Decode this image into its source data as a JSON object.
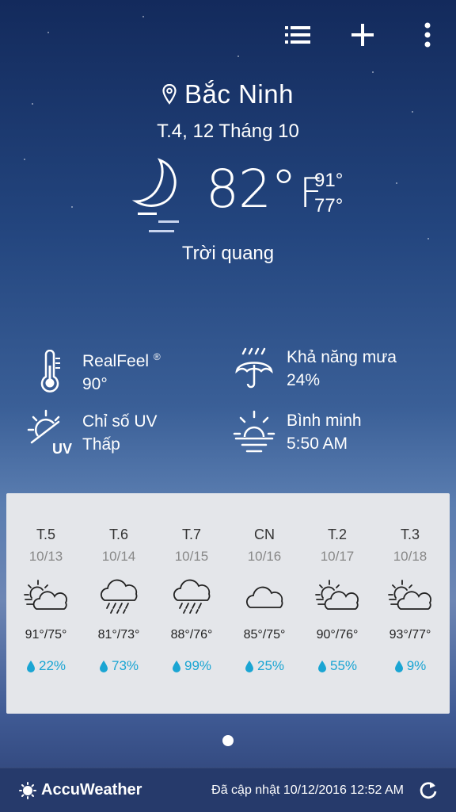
{
  "header": {
    "list_icon": "list-icon",
    "add_icon": "plus-icon",
    "menu_icon": "more-vert-icon"
  },
  "location": {
    "name": "Bắc Ninh",
    "icon": "location-pin-icon"
  },
  "date": "T.4, 12 Tháng 10",
  "current": {
    "temp": "82°",
    "unit": "F",
    "high": "91°",
    "low": "77°",
    "condition": "Trời quang",
    "icon": "moon-clear-night-icon"
  },
  "details": [
    {
      "label": "RealFeel",
      "sup": "®",
      "value": "90°",
      "icon": "thermometer-icon"
    },
    {
      "label": "Khả năng mưa",
      "value": "24%",
      "icon": "umbrella-rain-icon"
    },
    {
      "label": "Chỉ số UV",
      "value": "Thấp",
      "icon": "uv-index-icon"
    },
    {
      "label": "Bình minh",
      "value": "5:50 AM",
      "icon": "sunrise-icon"
    }
  ],
  "forecast": [
    {
      "day": "T.5",
      "date": "10/13",
      "temps": "91°/75°",
      "precip": "22%",
      "icon": "partly-cloudy-icon"
    },
    {
      "day": "T.6",
      "date": "10/14",
      "temps": "81°/73°",
      "precip": "73%",
      "icon": "rain-icon"
    },
    {
      "day": "T.7",
      "date": "10/15",
      "temps": "88°/76°",
      "precip": "99%",
      "icon": "rain-icon"
    },
    {
      "day": "CN",
      "date": "10/16",
      "temps": "85°/75°",
      "precip": "25%",
      "icon": "cloud-icon"
    },
    {
      "day": "T.2",
      "date": "10/17",
      "temps": "90°/76°",
      "precip": "55%",
      "icon": "partly-cloudy-icon"
    },
    {
      "day": "T.3",
      "date": "10/18",
      "temps": "93°/77°",
      "precip": "9%",
      "icon": "partly-cloudy-icon"
    }
  ],
  "footer": {
    "brand": "AccuWeather",
    "updated": "Đã cập nhật 10/12/2016 12:52 AM",
    "refresh_icon": "refresh-icon"
  },
  "colors": {
    "precip": "#1aa5d3",
    "panel": "#e4e6ea",
    "footer": "#263a6b"
  }
}
